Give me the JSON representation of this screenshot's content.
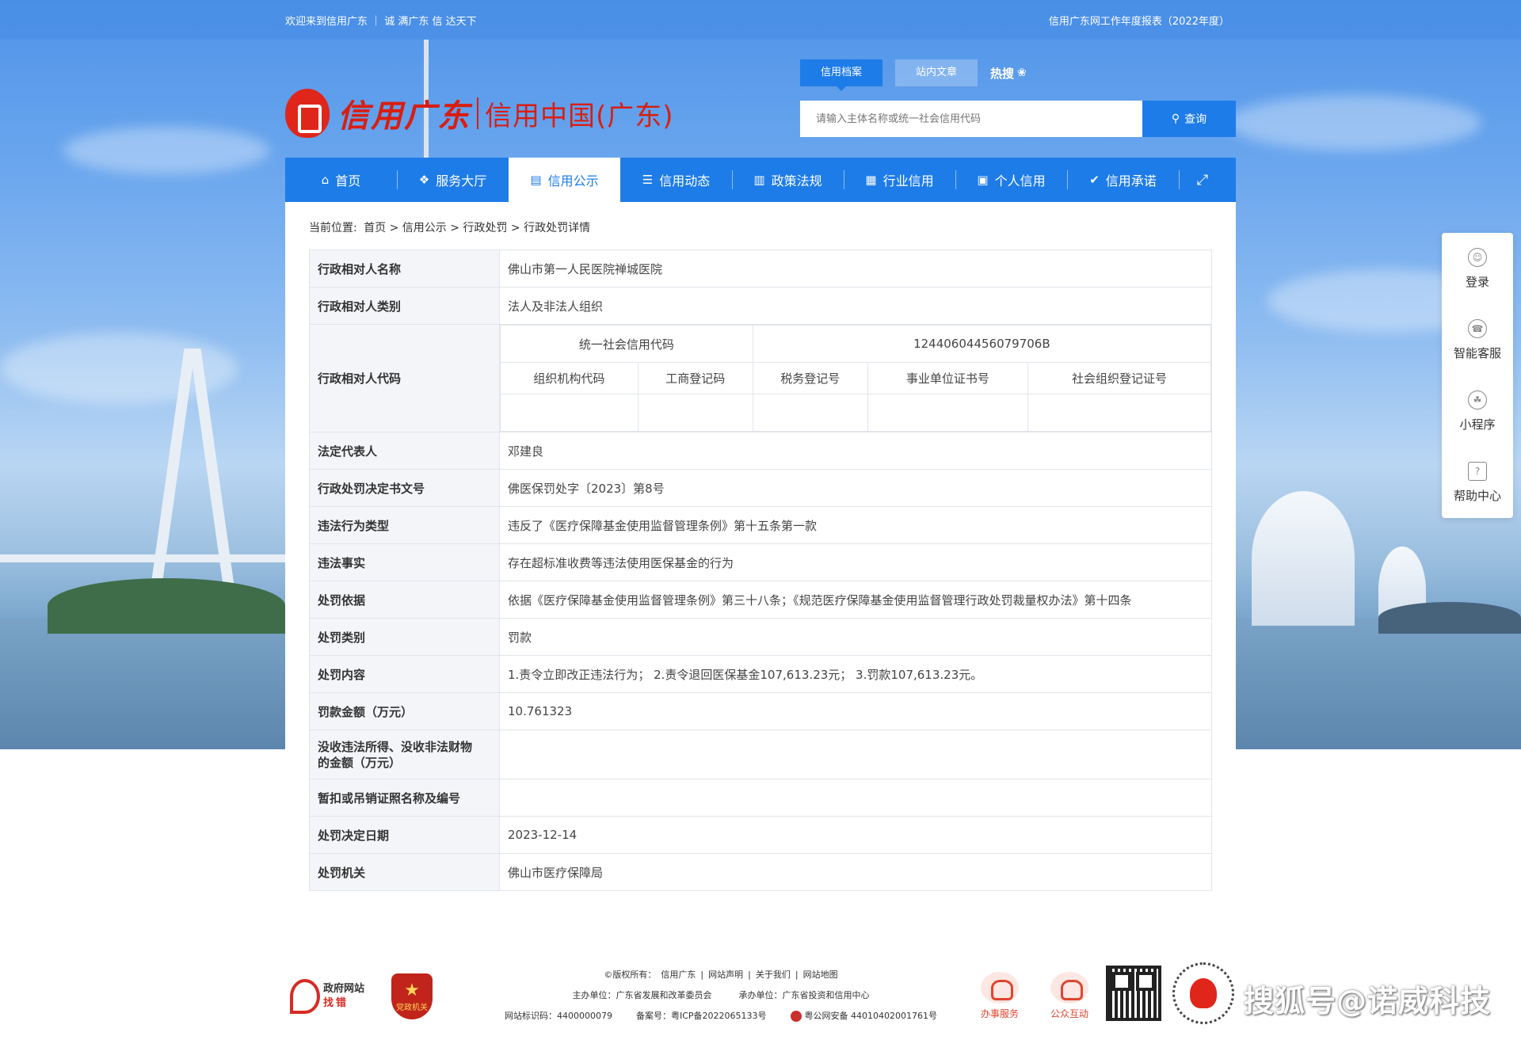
{
  "topbar": {
    "welcome": "欢迎来到信用广东 ｜ 诚 满广东  信 达天下",
    "report_link": "信用广东网工作年度报表（2022年度）"
  },
  "header": {
    "logo_cn": "信用广东",
    "logo_sub": "信用中国(广东)",
    "search_tabs": [
      "信用档案",
      "站内文章"
    ],
    "hot_label": "热搜",
    "search_placeholder": "请输入主体名称或统一社会信用代码",
    "search_button": "查询"
  },
  "nav": {
    "items": [
      {
        "label": "首页",
        "icon": "home-icon"
      },
      {
        "label": "服务大厅",
        "icon": "grid-icon"
      },
      {
        "label": "信用公示",
        "icon": "board-icon"
      },
      {
        "label": "信用动态",
        "icon": "news-icon"
      },
      {
        "label": "政策法规",
        "icon": "doc-icon"
      },
      {
        "label": "行业信用",
        "icon": "building-icon"
      },
      {
        "label": "个人信用",
        "icon": "person-icon"
      },
      {
        "label": "信用承诺",
        "icon": "shield-icon"
      }
    ],
    "active_index": 2
  },
  "breadcrumb": {
    "prefix": "当前位置:",
    "path": "首页 > 信用公示 > 行政处罚 > 行政处罚详情"
  },
  "detail": {
    "name_key": "行政相对人名称",
    "name_val": "佛山市第一人民医院禅城医院",
    "category_key": "行政相对人类别",
    "category_val": "法人及非法人组织",
    "code_key": "行政相对人代码",
    "usc_label": "统一社会信用代码",
    "usc_val": "12440604456079706B",
    "code_cols": [
      "组织机构代码",
      "工商登记码",
      "税务登记号",
      "事业单位证书号",
      "社会组织登记证号"
    ],
    "legal_rep_key": "法定代表人",
    "legal_rep_val": "邓建良",
    "doc_no_key": "行政处罚决定书文号",
    "doc_no_val": "佛医保罚处字〔2023〕第8号",
    "violation_type_key": "违法行为类型",
    "violation_type_val": "违反了《医疗保障基金使用监督管理条例》第十五条第一款",
    "facts_key": "违法事实",
    "facts_val": "存在超标准收费等违法使用医保基金的行为",
    "basis_key": "处罚依据",
    "basis_val": "依据《医疗保障基金使用监督管理条例》第三十八条；《规范医疗保障基金使用监督管理行政处罚裁量权办法》第十四条",
    "penalty_type_key": "处罚类别",
    "penalty_type_val": "罚款",
    "content_key": "处罚内容",
    "content_val": "1.责令立即改正违法行为； 2.责令退回医保基金107,613.23元； 3.罚款107,613.23元。",
    "fine_key": "罚款金额（万元）",
    "fine_val": "10.761323",
    "confiscate_key_1": "没收违法所得、没收非法财物",
    "confiscate_key_2": "的金额（万元）",
    "confiscate_val": "",
    "license_key": "暂扣或吊销证照名称及编号",
    "license_val": "",
    "date_key": "处罚决定日期",
    "date_val": "2023-12-14",
    "authority_key": "处罚机关",
    "authority_val": "佛山市医疗保障局"
  },
  "float_bar": [
    {
      "label": "登录",
      "icon": "user-icon"
    },
    {
      "label": "智能客服",
      "icon": "headset-icon"
    },
    {
      "label": "小程序",
      "icon": "miniapp-icon"
    },
    {
      "label": "帮助中心",
      "icon": "help-icon"
    }
  ],
  "footer": {
    "gov_badge_1": "政府网站",
    "gov_badge_2": "找错",
    "party_badge": "党政机关",
    "row1": [
      "©版权所有：",
      "信用广东",
      "|",
      "网站声明",
      "|",
      "关于我们",
      "|",
      "网站地图"
    ],
    "sponsor": "主办单位：广东省发展和改革委员会",
    "organizer": "承办单位：广东省投资和信用中心",
    "site_id": "网站标识码：4400000079",
    "icp": "备案号：粤ICP备2022065133号",
    "police": "粤公网安备 44010402001761号",
    "svc1": "办事服务",
    "svc2": "公众互动",
    "watermark": "搜狐号@诺威科技"
  }
}
